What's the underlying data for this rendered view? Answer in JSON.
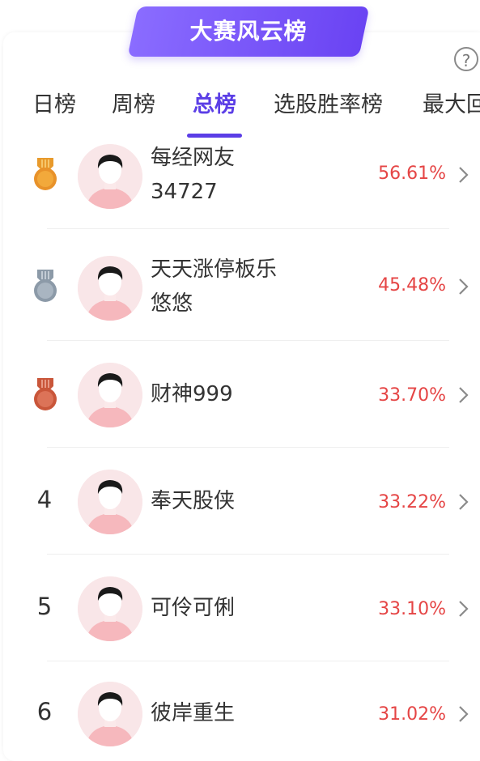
{
  "header": {
    "title": "大赛风云榜",
    "help_icon": "?"
  },
  "tabs": [
    {
      "label": "日榜",
      "active": false
    },
    {
      "label": "周榜",
      "active": false
    },
    {
      "label": "总榜",
      "active": true
    },
    {
      "label": "选股胜率榜",
      "active": false
    },
    {
      "label": "最大回",
      "active": false
    }
  ],
  "colors": {
    "accent": "#5b3ee6",
    "percent": "#e54545",
    "gold": "#e89a2c",
    "silver": "#8c9aa8",
    "bronze": "#c9563a"
  },
  "leaderboard": [
    {
      "rank": "1",
      "medal": "gold",
      "name_line1": "每经网友",
      "name_line2": "34727",
      "percent": "56.61%"
    },
    {
      "rank": "2",
      "medal": "silver",
      "name_line1": "天天涨停板乐",
      "name_line2": "悠悠",
      "percent": "45.48%"
    },
    {
      "rank": "3",
      "medal": "bronze",
      "name_line1": "财神999",
      "name_line2": "",
      "percent": "33.70%"
    },
    {
      "rank": "4",
      "medal": "",
      "name_line1": "奉天股侠",
      "name_line2": "",
      "percent": "33.22%"
    },
    {
      "rank": "5",
      "medal": "",
      "name_line1": "可伶可俐",
      "name_line2": "",
      "percent": "33.10%"
    },
    {
      "rank": "6",
      "medal": "",
      "name_line1": "彼岸重生",
      "name_line2": "",
      "percent": "31.02%"
    }
  ]
}
